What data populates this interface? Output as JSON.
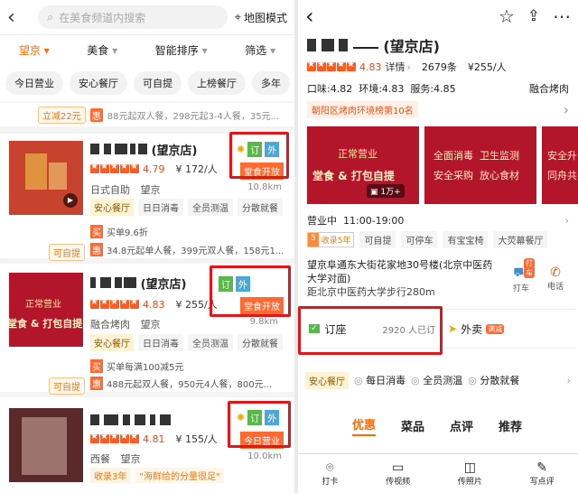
{
  "left": {
    "search_placeholder": "在美食频道内搜索",
    "map_mode": "地图模式",
    "filters": [
      "望京",
      "美食",
      "智能排序",
      "筛选"
    ],
    "chips": [
      "今日营业",
      "安心餐厅",
      "可自提",
      "上榜餐厅",
      "多年"
    ],
    "promo_top": {
      "badge": "立减22元",
      "hui": "惠",
      "text": "88元起双人餐，298元起3-4人餐，35元..."
    },
    "shops": [
      {
        "name_suffix": "(望京店)",
        "rating": "4.79",
        "price": "¥ 172/人",
        "cuisine": "日式自助",
        "area": "望京",
        "distance": "10.8km",
        "tags": [
          "订",
          "外"
        ],
        "status": "堂食开放",
        "safe": "安心餐厅",
        "features": [
          "日日消毒",
          "全员测温",
          "分散就餐"
        ],
        "promos": [
          {
            "icon": "买",
            "text": "买单9.6折"
          },
          {
            "icon": "惠",
            "text": "34.8元起单人餐，399元双人餐，158元1..."
          }
        ],
        "pickup": "可自提"
      },
      {
        "name_suffix": "(望京店)",
        "rating": "4.83",
        "price": "¥ 255/人",
        "cuisine": "融合烤肉",
        "area": "望京",
        "distance": "9.8km",
        "tags": [
          "订",
          "外"
        ],
        "status": "堂食开放",
        "safe": "安心餐厅",
        "features": [
          "日日消毒",
          "全员测温",
          "分散就餐"
        ],
        "img_lines": [
          "正常营业",
          "堂食 & 打包自提"
        ],
        "promos": [
          {
            "icon": "买",
            "text": "买单每满100减5元"
          },
          {
            "icon": "惠",
            "text": "488元起双人餐，950元4人餐，800元..."
          }
        ],
        "pickup": "可自提"
      },
      {
        "rating": "4.81",
        "price": "¥ 155/人",
        "cuisine": "西餐",
        "area": "望京",
        "distance": "10.0km",
        "tags": [
          "订",
          "外"
        ],
        "status": "今日营业",
        "years": "收录3年",
        "quote": "\"海鲜给的分量很足\""
      }
    ]
  },
  "right": {
    "shop_name_suffix": "(望京店)",
    "rating": "4.83",
    "detail": "详情",
    "reviews": "2679条",
    "price": "¥255/人",
    "scores": "口味:4.82  环境:4.83  服务:4.85",
    "category": "融合烤肉",
    "rank": "朝阳区烤肉环境榜第10名",
    "banners": [
      [
        "正常营业",
        "堂食 & 打包自提"
      ],
      [
        "全面消毒  卫生监测",
        "安全采购  放心食材"
      ],
      [
        "安全升",
        "同舟共"
      ]
    ],
    "photo_count": "1万+",
    "hours": "营业中  11:00-19:00",
    "years_num": "5",
    "years_text": "收录5年",
    "services": [
      "可自提",
      "可停车",
      "有宝宝椅",
      "大荧幕餐厅"
    ],
    "address": "望京阜通东大街花家地30号楼(北京中医药大学对面)",
    "distance": "距北京中医药大学步行280m",
    "taxi_badge": "打车",
    "taxi": "打车",
    "phone": "电话",
    "booking": "订座",
    "booked": "2920 人已订",
    "takeout": "外卖",
    "takeout_badge": "满减",
    "safe": "安心餐厅",
    "features": [
      "每日消毒",
      "全员测温",
      "分散就餐"
    ],
    "tabs": [
      "优惠",
      "菜品",
      "点评",
      "推荐"
    ],
    "bottom": [
      "打卡",
      "传视频",
      "传照片",
      "写点评"
    ]
  }
}
